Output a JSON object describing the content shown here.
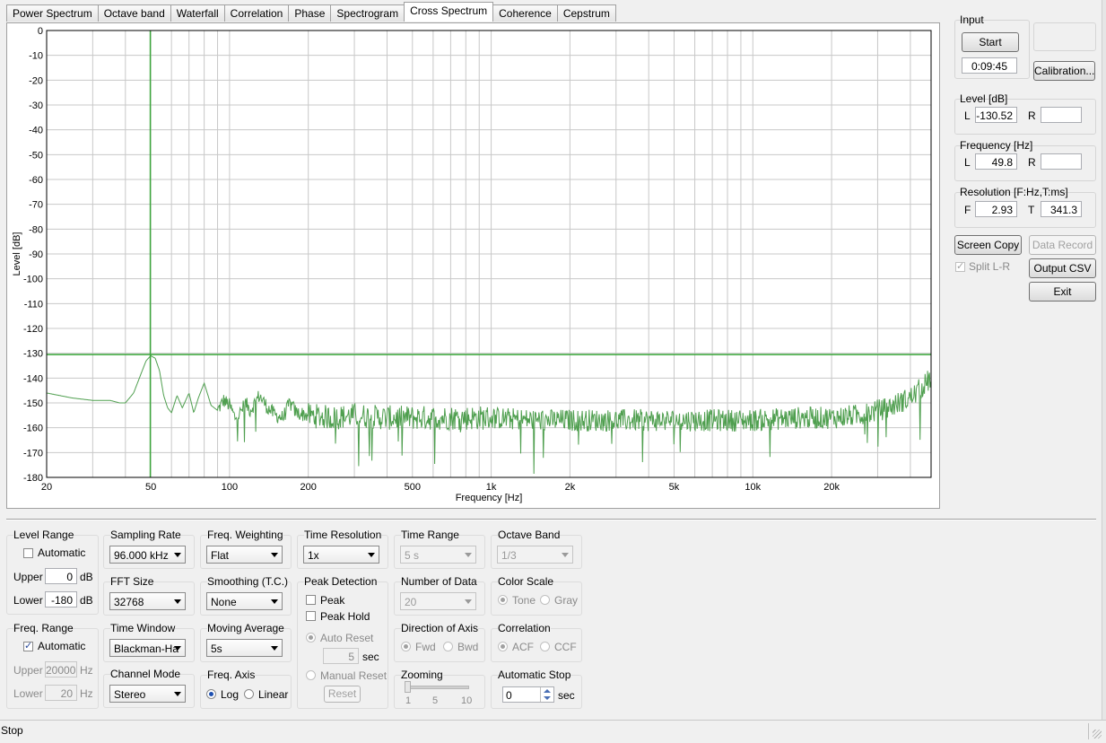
{
  "tabs": [
    "Power Spectrum",
    "Octave band",
    "Waterfall",
    "Correlation",
    "Phase",
    "Spectrogram",
    "Cross Spectrum",
    "Coherence",
    "Cepstrum"
  ],
  "active_tab": "Cross Spectrum",
  "chart_data": {
    "type": "line",
    "xscale": "log",
    "xlim": [
      20,
      48000
    ],
    "ylim": [
      -180,
      0
    ],
    "xlabel": "Frequency [Hz]",
    "ylabel": "Level [dB]",
    "x_ticks": [
      20,
      50,
      100,
      200,
      500,
      1000,
      2000,
      5000,
      10000,
      20000
    ],
    "x_tick_labels": [
      "20",
      "50",
      "100",
      "200",
      "500",
      "1k",
      "2k",
      "5k",
      "10k",
      "20k"
    ],
    "y_ticks": [
      0,
      -10,
      -20,
      -30,
      -40,
      -50,
      -60,
      -70,
      -80,
      -90,
      -100,
      -110,
      -120,
      -130,
      -140,
      -150,
      -160,
      -170,
      -180
    ],
    "grid": true,
    "cursor": {
      "x": 49.8,
      "y": -130.52,
      "color": "#3aa63a"
    },
    "series": [
      {
        "color": "#4f9f4f",
        "x": [
          20,
          25,
          30,
          35,
          38,
          40,
          43,
          46,
          48,
          50,
          52,
          54,
          56,
          58,
          60,
          63,
          66,
          70,
          73,
          76,
          80,
          85,
          90,
          95,
          100,
          105,
          110,
          115,
          120,
          130,
          140,
          150,
          160,
          170,
          180,
          200,
          250,
          300,
          400,
          500,
          700,
          1000,
          1500,
          2000,
          3000,
          5000,
          7000,
          10000,
          15000,
          20000,
          25000,
          28000,
          30000,
          33000,
          36000,
          40000,
          44000,
          48000
        ],
        "y": [
          -146,
          -148,
          -149,
          -149,
          -150,
          -150,
          -146,
          -138,
          -133,
          -131,
          -132,
          -137,
          -147,
          -152,
          -154,
          -147,
          -152,
          -146,
          -154,
          -148,
          -142,
          -151,
          -153,
          -149,
          -151,
          -156,
          -154,
          -150,
          -153,
          -147,
          -152,
          -155,
          -156,
          -150,
          -154,
          -155,
          -156,
          -155,
          -156,
          -156,
          -156,
          -156,
          -157,
          -157,
          -157,
          -157,
          -157,
          -157,
          -156,
          -156,
          -155,
          -154,
          -153,
          -152,
          -150,
          -148,
          -144,
          -140
        ]
      }
    ]
  },
  "right": {
    "input_label": "Input",
    "start": "Start",
    "elapsed": "0:09:45",
    "calibration": "Calibration...",
    "level_label": "Level [dB]",
    "level_L": "-130.52",
    "level_R": "",
    "freq_label": "Frequency [Hz]",
    "freq_L": "49.8",
    "freq_R": "",
    "res_label": "Resolution [F:Hz,T:ms]",
    "res_F": "2.93",
    "res_T": "341.3",
    "L": "L",
    "R": "R",
    "F": "F",
    "T": "T",
    "screen_copy": "Screen Copy",
    "data_record": "Data Record",
    "split": "Split L-R",
    "output_csv": "Output CSV",
    "exit": "Exit"
  },
  "controls": {
    "level_range": {
      "title": "Level Range",
      "automatic": "Automatic",
      "upper_label": "Upper",
      "upper": "0",
      "lower_label": "Lower",
      "lower": "-180",
      "unit": "dB"
    },
    "freq_range": {
      "title": "Freq. Range",
      "automatic": "Automatic",
      "upper_label": "Upper",
      "upper": "20000",
      "lower_label": "Lower",
      "lower": "20",
      "unit": "Hz"
    },
    "sampling_rate": {
      "title": "Sampling Rate",
      "value": "96.000 kHz"
    },
    "fft_size": {
      "title": "FFT Size",
      "value": "32768"
    },
    "time_window": {
      "title": "Time Window",
      "value": "Blackman-Ha"
    },
    "channel_mode": {
      "title": "Channel Mode",
      "value": "Stereo"
    },
    "freq_weighting": {
      "title": "Freq. Weighting",
      "value": "Flat"
    },
    "smoothing": {
      "title": "Smoothing (T.C.)",
      "value": "None"
    },
    "moving_average": {
      "title": "Moving Average",
      "value": "5s"
    },
    "freq_axis": {
      "title": "Freq. Axis",
      "log": "Log",
      "linear": "Linear"
    },
    "time_resolution": {
      "title": "Time Resolution",
      "value": "1x"
    },
    "peak_detection": {
      "title": "Peak Detection",
      "peak": "Peak",
      "peak_hold": "Peak Hold",
      "auto_reset": "Auto Reset",
      "sec_value": "5",
      "sec": "sec",
      "manual_reset": "Manual Reset",
      "reset": "Reset"
    },
    "time_range": {
      "title": "Time Range",
      "value": "5 s"
    },
    "number_of_data": {
      "title": "Number of Data",
      "value": "20"
    },
    "direction": {
      "title": "Direction of Axis",
      "fwd": "Fwd",
      "bwd": "Bwd"
    },
    "zooming": {
      "title": "Zooming",
      "t1": "1",
      "t5": "5",
      "t10": "10"
    },
    "octave_band": {
      "title": "Octave Band",
      "value": "1/3"
    },
    "color_scale": {
      "title": "Color Scale",
      "tone": "Tone",
      "gray": "Gray"
    },
    "correlation": {
      "title": "Correlation",
      "acf": "ACF",
      "ccf": "CCF"
    },
    "auto_stop": {
      "title": "Automatic Stop",
      "value": "0",
      "unit": "sec"
    }
  },
  "status": "Stop"
}
